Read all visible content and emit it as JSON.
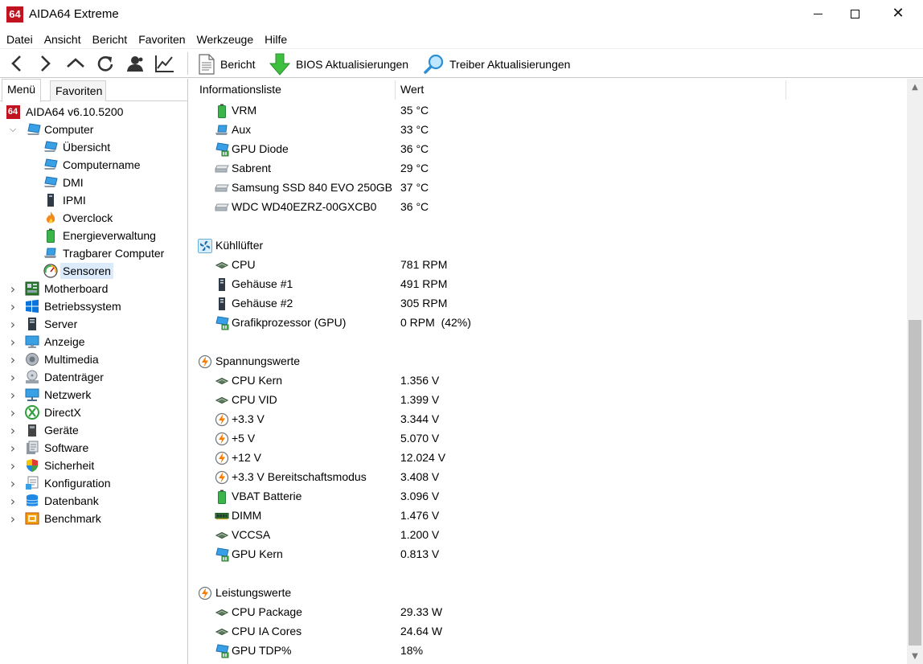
{
  "window": {
    "logo_text": "64",
    "title": "AIDA64 Extreme"
  },
  "menu": [
    "Datei",
    "Ansicht",
    "Bericht",
    "Favoriten",
    "Werkzeuge",
    "Hilfe"
  ],
  "toolbar": {
    "report_label": "Bericht",
    "bios_label": "BIOS Aktualisierungen",
    "driver_label": "Treiber Aktualisierungen"
  },
  "tabs": {
    "menu_label": "Menü",
    "favorites_label": "Favoriten"
  },
  "tree": {
    "root_label": "AIDA64 v6.10.5200",
    "computer_label": "Computer",
    "computer_children": [
      {
        "label": "Übersicht",
        "icon": "monitor-icon"
      },
      {
        "label": "Computername",
        "icon": "monitor-icon"
      },
      {
        "label": "DMI",
        "icon": "monitor-icon"
      },
      {
        "label": "IPMI",
        "icon": "tower-icon"
      },
      {
        "label": "Overclock",
        "icon": "flame-icon"
      },
      {
        "label": "Energieverwaltung",
        "icon": "battery-icon"
      },
      {
        "label": "Tragbarer Computer",
        "icon": "laptop-icon"
      },
      {
        "label": "Sensoren",
        "icon": "gauge-icon",
        "selected": true
      }
    ],
    "categories": [
      {
        "label": "Motherboard",
        "icon": "motherboard-icon"
      },
      {
        "label": "Betriebssystem",
        "icon": "windows-icon"
      },
      {
        "label": "Server",
        "icon": "server-icon"
      },
      {
        "label": "Anzeige",
        "icon": "display-icon"
      },
      {
        "label": "Multimedia",
        "icon": "speaker-icon"
      },
      {
        "label": "Datenträger",
        "icon": "disk-icon"
      },
      {
        "label": "Netzwerk",
        "icon": "network-icon"
      },
      {
        "label": "DirectX",
        "icon": "xbox-icon"
      },
      {
        "label": "Geräte",
        "icon": "devices-icon"
      },
      {
        "label": "Software",
        "icon": "software-icon"
      },
      {
        "label": "Sicherheit",
        "icon": "shield-icon"
      },
      {
        "label": "Konfiguration",
        "icon": "config-icon"
      },
      {
        "label": "Datenbank",
        "icon": "database-icon"
      },
      {
        "label": "Benchmark",
        "icon": "benchmark-icon"
      }
    ]
  },
  "list": {
    "col_info": "Informationsliste",
    "col_value": "Wert",
    "rows": [
      {
        "type": "item",
        "icon": "battery-icon",
        "label": "VRM",
        "value": "35 °C"
      },
      {
        "type": "item",
        "icon": "laptop-icon",
        "label": "Aux",
        "value": "33 °C"
      },
      {
        "type": "item",
        "icon": "gpu-icon",
        "label": "GPU Diode",
        "value": "36 °C"
      },
      {
        "type": "item",
        "icon": "drive-icon",
        "label": "Sabrent",
        "value": "29 °C"
      },
      {
        "type": "item",
        "icon": "drive-icon",
        "label": "Samsung SSD 840 EVO 250GB",
        "value": "37 °C"
      },
      {
        "type": "item",
        "icon": "drive-icon",
        "label": "WDC WD40EZRZ-00GXCB0",
        "value": "36 °C"
      },
      {
        "type": "spacer"
      },
      {
        "type": "group",
        "icon": "fan-icon",
        "label": "Kühllüfter"
      },
      {
        "type": "item",
        "icon": "cpu-icon",
        "label": "CPU",
        "value": "781 RPM"
      },
      {
        "type": "item",
        "icon": "case-icon",
        "label": "Gehäuse #1",
        "value": "491 RPM"
      },
      {
        "type": "item",
        "icon": "case-icon",
        "label": "Gehäuse #2",
        "value": "305 RPM"
      },
      {
        "type": "item",
        "icon": "gpu-icon",
        "label": "Grafikprozessor (GPU)",
        "value": "0 RPM  (42%)"
      },
      {
        "type": "spacer"
      },
      {
        "type": "group",
        "icon": "voltage-icon",
        "label": "Spannungswerte"
      },
      {
        "type": "item",
        "icon": "cpu-icon",
        "label": "CPU Kern",
        "value": "1.356 V"
      },
      {
        "type": "item",
        "icon": "cpu-icon",
        "label": "CPU VID",
        "value": "1.399 V"
      },
      {
        "type": "item",
        "icon": "voltage-icon",
        "label": "+3.3 V",
        "value": "3.344 V"
      },
      {
        "type": "item",
        "icon": "voltage-icon",
        "label": "+5 V",
        "value": "5.070 V"
      },
      {
        "type": "item",
        "icon": "voltage-icon",
        "label": "+12 V",
        "value": "12.024 V"
      },
      {
        "type": "item",
        "icon": "voltage-icon",
        "label": "+3.3 V Bereitschaftsmodus",
        "value": "3.408 V"
      },
      {
        "type": "item",
        "icon": "battery-icon",
        "label": "VBAT Batterie",
        "value": "3.096 V"
      },
      {
        "type": "item",
        "icon": "ram-icon",
        "label": "DIMM",
        "value": "1.476 V"
      },
      {
        "type": "item",
        "icon": "cpu-icon",
        "label": "VCCSA",
        "value": "1.200 V"
      },
      {
        "type": "item",
        "icon": "gpu-icon",
        "label": "GPU Kern",
        "value": "0.813 V"
      },
      {
        "type": "spacer"
      },
      {
        "type": "group",
        "icon": "voltage-icon",
        "label": "Leistungswerte"
      },
      {
        "type": "item",
        "icon": "cpu-icon",
        "label": "CPU Package",
        "value": "29.33 W"
      },
      {
        "type": "item",
        "icon": "cpu-icon",
        "label": "CPU IA Cores",
        "value": "24.64 W"
      },
      {
        "type": "item",
        "icon": "gpu-icon",
        "label": "GPU TDP%",
        "value": "18%"
      }
    ]
  }
}
